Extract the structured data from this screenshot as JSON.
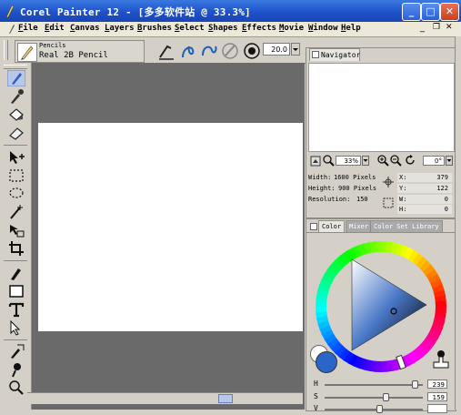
{
  "window": {
    "title": "Corel Painter 12 - [多多软件站 @ 33.3%]",
    "buttons": {
      "minimize": "_",
      "maximize": "□",
      "close": "✕"
    }
  },
  "menu": [
    "File",
    "Edit",
    "Canvas",
    "Layers",
    "Brushes",
    "Select",
    "Shapes",
    "Effects",
    "Movie",
    "Window",
    "Help"
  ],
  "brush": {
    "category": "Pencils",
    "variant": "Real 2B Pencil",
    "size": "20.0"
  },
  "navigator": {
    "tab": "Navigator",
    "zoom": "33%",
    "rotation": "0°",
    "width_label": "Width:",
    "width_value": "1600 Pixels",
    "height_label": "Height:",
    "height_value": "900 Pixels",
    "resolution_label": "Resolution:",
    "resolution_value": "150",
    "x_label": "X:",
    "x_value": "379",
    "y_label": "Y:",
    "y_value": "122",
    "w_label": "W:",
    "w_value": "0",
    "h_label": "H:",
    "h_value": "0"
  },
  "color_panel": {
    "tabs": [
      "Color",
      "Mixer",
      "Color Set Library"
    ],
    "sliders": [
      {
        "label": "H",
        "value": "239",
        "level": 0.92
      },
      {
        "label": "S",
        "value": "159",
        "level": 0.62
      },
      {
        "label": "V",
        "value": "",
        "level": 0.55
      }
    ],
    "main_color": "#2a66c8",
    "secondary_color": "#ffffff"
  }
}
